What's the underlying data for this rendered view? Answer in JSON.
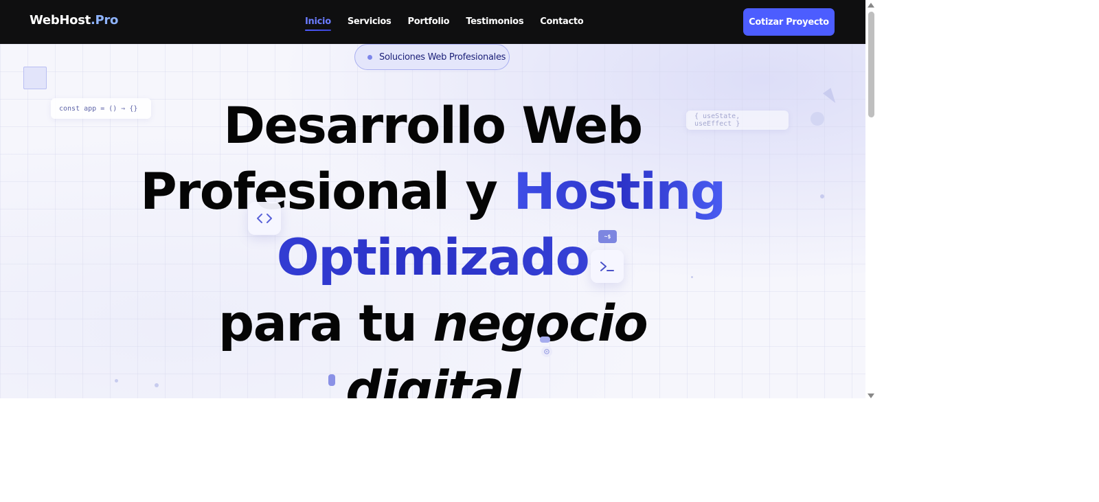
{
  "navbar": {
    "logo_main": "WebHost",
    "logo_accent": ".Pro",
    "links": [
      "Inicio",
      "Servicios",
      "Portfolio",
      "Testimonios",
      "Contacto"
    ],
    "active_link": "Inicio",
    "cta_label": "Cotizar Proyecto"
  },
  "hero": {
    "badge": "Soluciones Web Profesionales",
    "code_chip_1": "const app = () ⇒ {}",
    "code_chip_2": "{ useState, useEffect }",
    "headline": {
      "line1": "Desarrollo Web",
      "line2_plain": "Profesional y ",
      "line2_gradient": "Hosting",
      "line3_gradient": "Optimizado",
      "line4_plain": "para tu ",
      "line4_italic": "negocio",
      "line5_italic": "digital"
    },
    "floating_icons": {
      "code_icon": "‹›",
      "terminal_icon": "›_",
      "dollar_chip": "~$"
    }
  },
  "colors": {
    "navbar_bg": "#0f0f10",
    "accent": "#4c5dff",
    "gradient_start": "#3f4fe8",
    "gradient_end": "#2b32c7"
  }
}
